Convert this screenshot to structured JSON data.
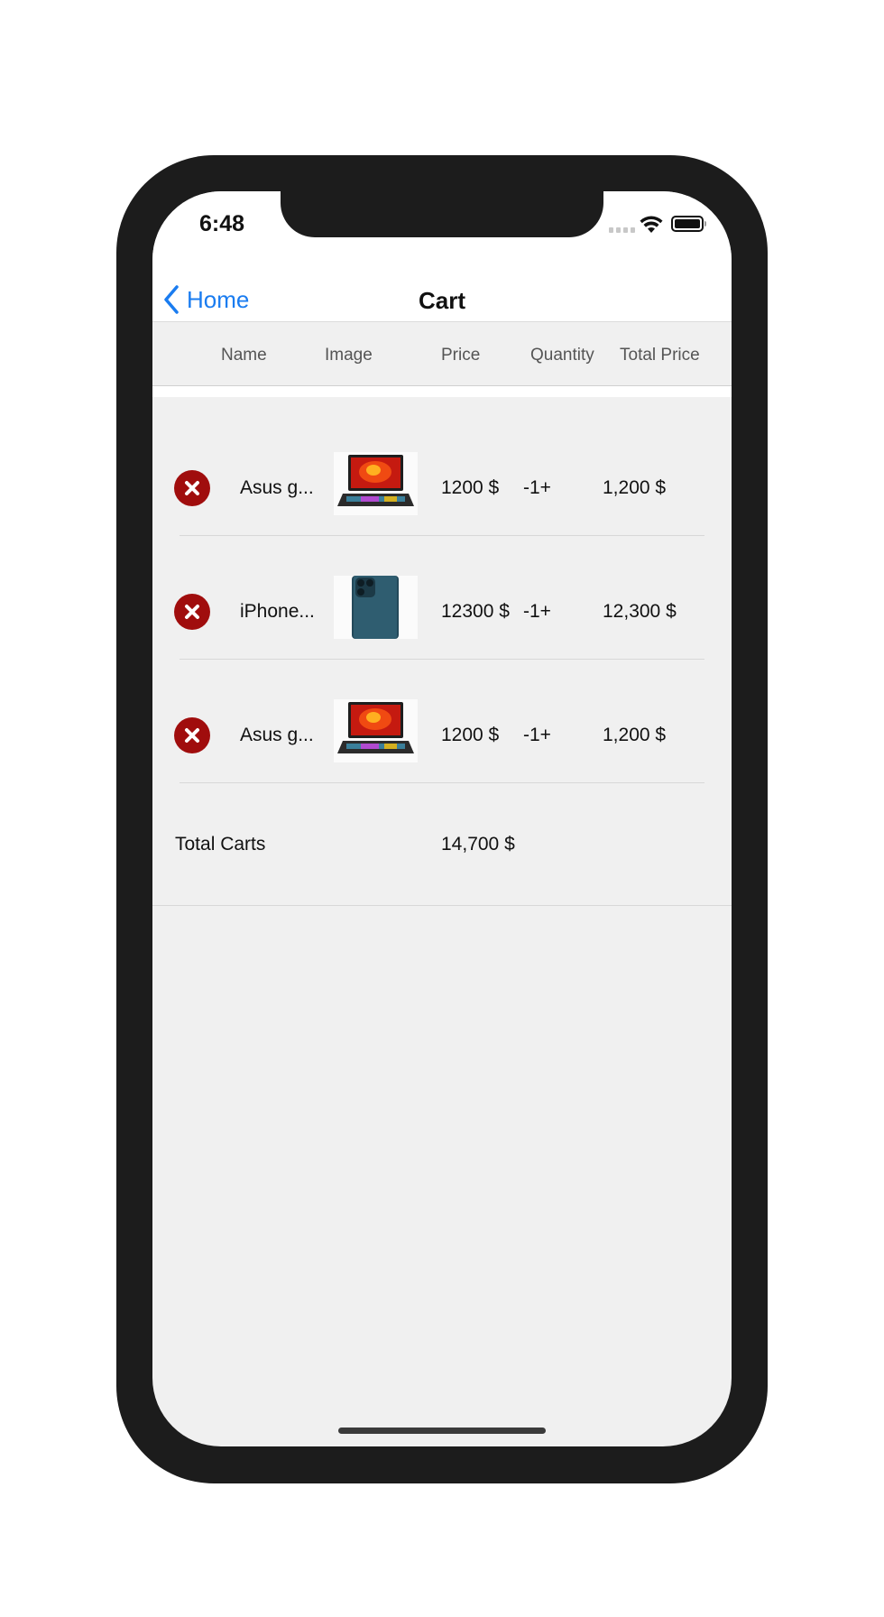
{
  "status_bar": {
    "time": "6:48"
  },
  "nav": {
    "back_label": "Home",
    "title": "Cart"
  },
  "table_header": {
    "name": "Name",
    "image": "Image",
    "price": "Price",
    "quantity": "Quantity",
    "total_price": "Total Price"
  },
  "rows": [
    {
      "name": "Asus g...",
      "image_icon": "laptop-product-image",
      "price": "1200 $",
      "quantity": "-1+",
      "total": "1,200 $"
    },
    {
      "name": "iPhone...",
      "image_icon": "phone-product-image",
      "price": "12300 $",
      "quantity": "-1+",
      "total": "12,300 $"
    },
    {
      "name": "Asus g...",
      "image_icon": "laptop-product-image",
      "price": "1200 $",
      "quantity": "-1+",
      "total": "1,200 $"
    }
  ],
  "summary": {
    "label": "Total Carts",
    "value": "14,700 $"
  },
  "colors": {
    "accent": "#1a7cf0",
    "remove": "#a00d0d",
    "background": "#f0f0f0"
  }
}
